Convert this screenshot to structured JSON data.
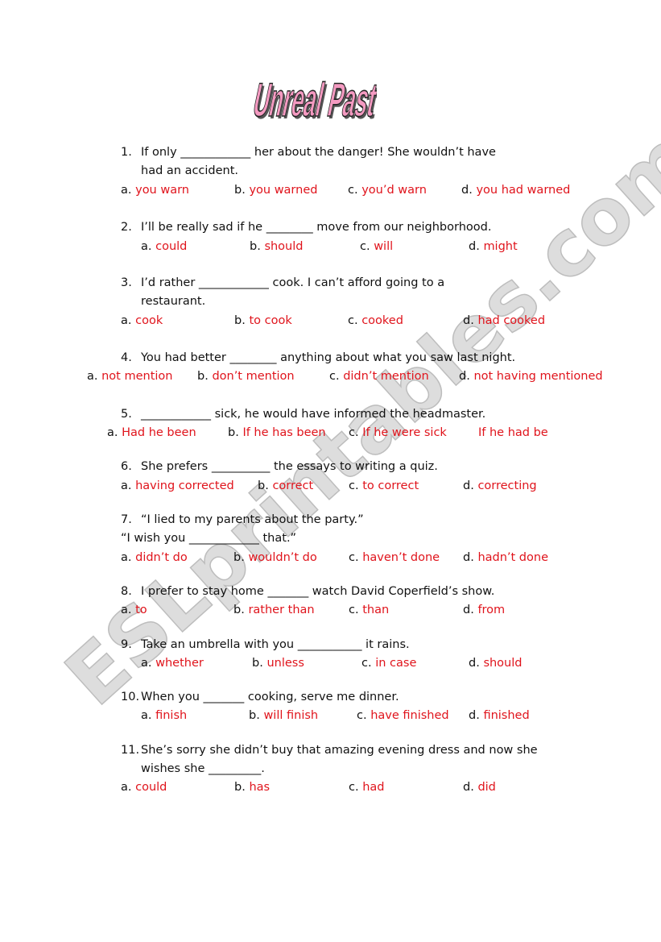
{
  "title": "Unreal Past",
  "watermark": "ESLprintables.com",
  "colors": {
    "answer": "#e0141c",
    "title_fill": "#f49ac1",
    "watermark": "#c8c8c8"
  },
  "questions": [
    {
      "number": "1.",
      "lines": [
        "If only ____________ her about the danger! She wouldn’t have",
        "had an accident."
      ],
      "options": [
        {
          "letter": "a.",
          "text": "you warn"
        },
        {
          "letter": "b.",
          "text": "you warned"
        },
        {
          "letter": "c.",
          "text": "you’d warn"
        },
        {
          "letter": "d.",
          "text": "you had warned"
        }
      ]
    },
    {
      "number": "2.",
      "lines": [
        "I’ll be really sad if he ________ move from our neighborhood."
      ],
      "options": [
        {
          "letter": "a.",
          "text": "could"
        },
        {
          "letter": "b.",
          "text": "should"
        },
        {
          "letter": "c.",
          "text": "will"
        },
        {
          "letter": "d.",
          "text": "might"
        }
      ]
    },
    {
      "number": "3.",
      "lines": [
        "I’d rather ____________ cook. I can’t afford going to a",
        "restaurant."
      ],
      "options": [
        {
          "letter": "a.",
          "text": "cook"
        },
        {
          "letter": "b.",
          "text": "to cook"
        },
        {
          "letter": "c.",
          "text": "cooked"
        },
        {
          "letter": "d.",
          "text": "had cooked"
        }
      ]
    },
    {
      "number": "4.",
      "lines": [
        "You had better ________ anything about what you saw last night."
      ],
      "options": [
        {
          "letter": "a.",
          "text": "not mention"
        },
        {
          "letter": "b.",
          "text": "don’t mention"
        },
        {
          "letter": "c.",
          "text": "didn’t mention"
        },
        {
          "letter": "d.",
          "text": "not having mentioned"
        }
      ]
    },
    {
      "number": "5.",
      "lines": [
        "____________ sick, he would have informed the headmaster."
      ],
      "options": [
        {
          "letter": "a.",
          "text": "Had he been"
        },
        {
          "letter": "b.",
          "text": "If he has been"
        },
        {
          "letter": "c.",
          "text": "If he were sick"
        },
        {
          "letter": "",
          "text": "If he had be"
        }
      ]
    },
    {
      "number": "6.",
      "lines": [
        "She prefers __________ the essays to writing a quiz."
      ],
      "options": [
        {
          "letter": "a.",
          "text": "having corrected"
        },
        {
          "letter": "b.",
          "text": "correct"
        },
        {
          "letter": "c.",
          "text": "to correct"
        },
        {
          "letter": "d.",
          "text": "correcting"
        }
      ]
    },
    {
      "number": "7.",
      "lines": [
        "“I lied to my parents about the party.”",
        "“I wish you ____________ that.”"
      ],
      "options": [
        {
          "letter": "a.",
          "text": "didn’t do"
        },
        {
          "letter": "b.",
          "text": "wouldn’t do"
        },
        {
          "letter": "c.",
          "text": "haven’t done"
        },
        {
          "letter": "d.",
          "text": "hadn’t done"
        }
      ]
    },
    {
      "number": "8.",
      "lines": [
        "I prefer to stay home _______ watch David Coperfield’s show."
      ],
      "options": [
        {
          "letter": "a.",
          "text": "to"
        },
        {
          "letter": "b.",
          "text": "rather than"
        },
        {
          "letter": "c.",
          "text": "than"
        },
        {
          "letter": "d.",
          "text": "from"
        }
      ]
    },
    {
      "number": "9.",
      "lines": [
        "Take an umbrella with you ___________ it rains."
      ],
      "options": [
        {
          "letter": "a.",
          "text": "whether"
        },
        {
          "letter": "b.",
          "text": "unless"
        },
        {
          "letter": "c.",
          "text": "in case"
        },
        {
          "letter": "d.",
          "text": "should"
        }
      ]
    },
    {
      "number": "10.",
      "lines": [
        "When you _______ cooking, serve me dinner."
      ],
      "options": [
        {
          "letter": "a.",
          "text": "finish"
        },
        {
          "letter": "b.",
          "text": "will finish"
        },
        {
          "letter": "c.",
          "text": "have finished"
        },
        {
          "letter": "d.",
          "text": "finished"
        }
      ]
    },
    {
      "number": "11.",
      "lines": [
        "She’s sorry she didn’t buy that amazing evening dress and now she",
        "wishes she _________."
      ],
      "options": [
        {
          "letter": "a.",
          "text": "could"
        },
        {
          "letter": "b.",
          "text": "has"
        },
        {
          "letter": "c.",
          "text": "had"
        },
        {
          "letter": "d.",
          "text": "did"
        }
      ]
    }
  ]
}
